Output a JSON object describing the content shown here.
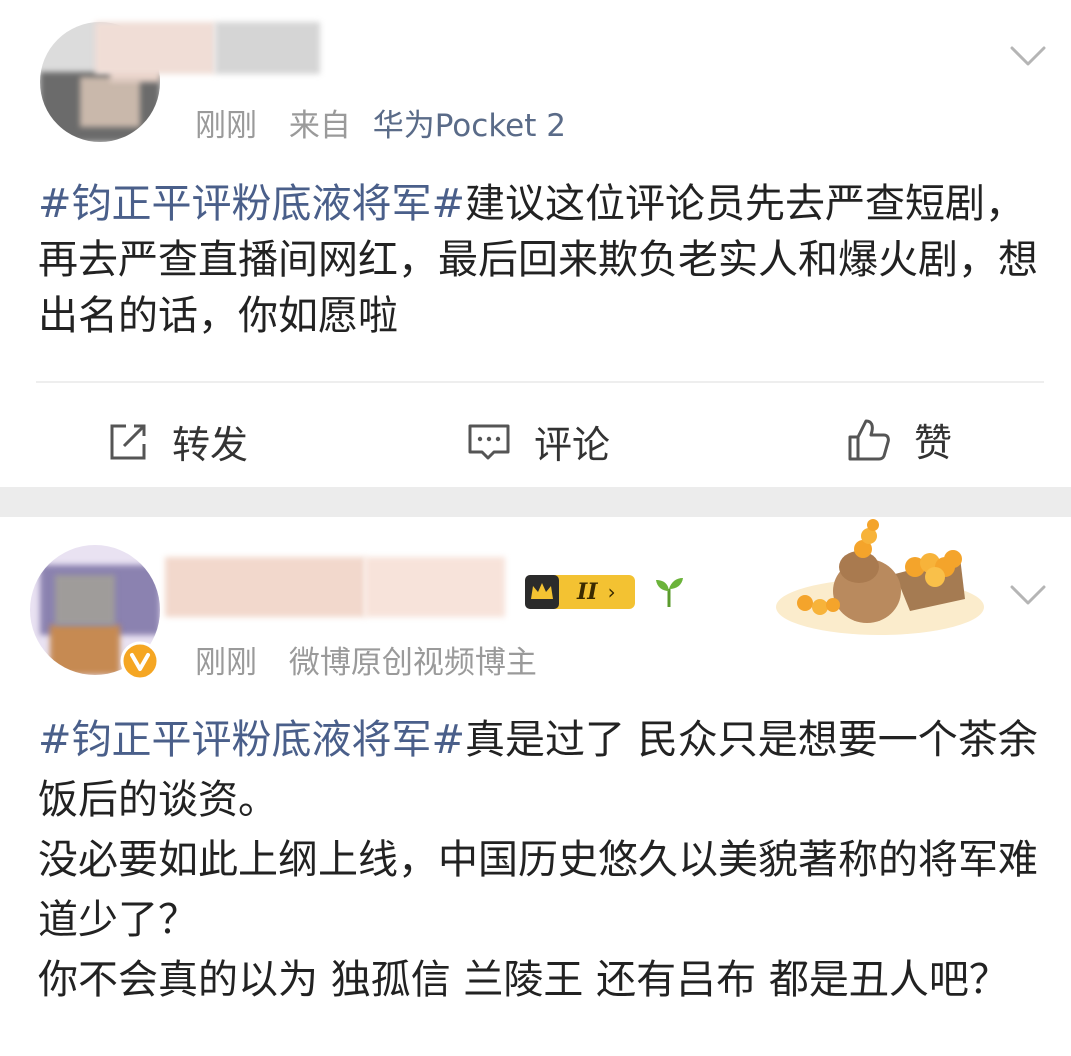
{
  "posts": [
    {
      "time": "刚刚",
      "source_prefix": "来自",
      "source_device": "华为Pocket 2",
      "topic": "#钧正平评粉底液将军#",
      "text": "建议这位评论员先去严查短剧，再去严查直播间网红，最后回来欺负老实人和爆火剧，想出名的话，你如愿啦",
      "actions": {
        "repost": "转发",
        "comment": "评论",
        "like": "赞"
      }
    },
    {
      "time": "刚刚",
      "user_title": "微博原创视频博主",
      "level_badge": "II",
      "topic": "#钧正平评粉底液将军#",
      "lines": [
        "真是过了 民众只是想要一个茶余饭后的谈资。",
        "没必要如此上纲上线，中国历史悠久以美貌著称的将军难道少了？",
        "你不会真的以为 独孤信 兰陵王 还有吕布 都是丑人吧？"
      ]
    }
  ],
  "icons": [
    "chevron-down-icon",
    "repost-icon",
    "comment-icon",
    "like-icon",
    "verified-badge-icon",
    "sprout-icon"
  ],
  "colors": {
    "topic": "#4a5f8a",
    "meta": "#9a9a9a",
    "divider": "#ececec",
    "verified": "#f5a623"
  }
}
